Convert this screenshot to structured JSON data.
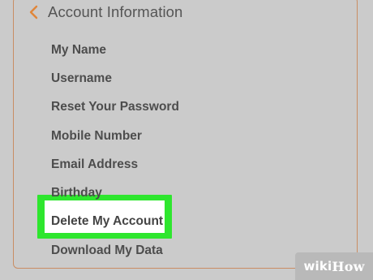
{
  "header": {
    "back_icon": "chevron-left-icon",
    "title": "Account Information"
  },
  "menu": {
    "items": [
      {
        "label": "My Name"
      },
      {
        "label": "Username"
      },
      {
        "label": "Reset Your Password"
      },
      {
        "label": "Mobile Number"
      },
      {
        "label": "Email Address"
      },
      {
        "label": "Birthday"
      },
      {
        "label": "Delete My Account",
        "highlighted": true
      },
      {
        "label": "Download My Data"
      }
    ]
  },
  "highlight": {
    "color": "#2ee62e"
  },
  "watermark": {
    "wiki": "wiki",
    "how": "How"
  },
  "colors": {
    "accent": "#e0863a",
    "background": "#cbcbcb",
    "text": "#4d4d4d"
  }
}
